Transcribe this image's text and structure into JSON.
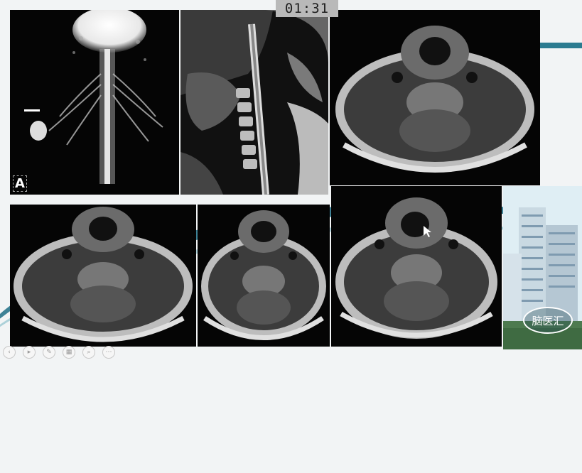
{
  "timer": {
    "text": "01:31"
  },
  "panels": {
    "mr_neurography": {
      "orientation_label": "A"
    }
  },
  "branding": {
    "logo_text": "脑医汇"
  },
  "toolbar": {
    "icons": [
      "prev-icon",
      "play-icon",
      "pen-icon",
      "grid-icon",
      "zoom-icon",
      "menu-icon"
    ],
    "glyphs": [
      "‹",
      "▸",
      "✎",
      "▦",
      "⌕",
      "⋯"
    ]
  },
  "colors": {
    "accent": "#1f6f86",
    "slide_bg": "#f2f4f5",
    "panel_bg": "#050505"
  }
}
